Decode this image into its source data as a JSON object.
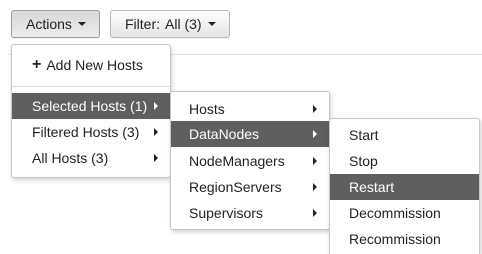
{
  "toolbar": {
    "actions_label": "Actions",
    "filter_label": "Filter:",
    "filter_value": "All (3)"
  },
  "actions_menu": {
    "add_new_hosts": "Add New Hosts",
    "items": [
      {
        "label": "Selected Hosts (1)"
      },
      {
        "label": "Filtered Hosts (3)"
      },
      {
        "label": "All Hosts (3)"
      }
    ]
  },
  "selected_hosts_menu": {
    "items": [
      {
        "label": "Hosts"
      },
      {
        "label": "DataNodes"
      },
      {
        "label": "NodeManagers"
      },
      {
        "label": "RegionServers"
      },
      {
        "label": "Supervisors"
      }
    ]
  },
  "datanodes_menu": {
    "items": [
      {
        "label": "Start"
      },
      {
        "label": "Stop"
      },
      {
        "label": "Restart"
      },
      {
        "label": "Decommission"
      },
      {
        "label": "Recommission"
      }
    ]
  },
  "colors": {
    "highlight": "#5f5f5f",
    "highlight_text": "#ffffff",
    "menu_border": "#c7c7c7"
  },
  "icons": {
    "add": "plus-icon",
    "dropdown": "caret-down-icon",
    "submenu": "chevron-right-icon"
  }
}
